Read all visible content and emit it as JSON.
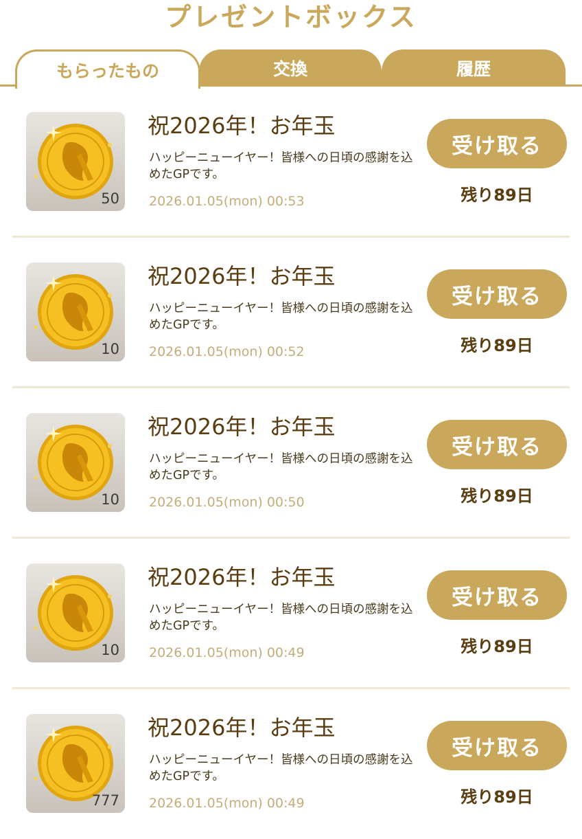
{
  "header": {
    "title": "プレゼントボックス"
  },
  "tabs": [
    {
      "label": "もらったもの",
      "active": true
    },
    {
      "label": "交換",
      "active": false
    },
    {
      "label": "履歴",
      "active": false
    }
  ],
  "colors": {
    "accent": "#c9a75b",
    "text_dark": "#5a3e12",
    "date": "#c5ad7b",
    "divider": "#efe6d4"
  },
  "items": [
    {
      "icon": "gold-coin-icon",
      "quantity": "50",
      "title": "祝2026年！お年玉",
      "description": "ハッピーニューイヤー！皆様への日頃の感謝を込めたGPです。",
      "date": "2026.01.05(mon) 00:53",
      "button_label": "受け取る",
      "remaining": "残り89日"
    },
    {
      "icon": "gold-coin-icon",
      "quantity": "10",
      "title": "祝2026年！お年玉",
      "description": "ハッピーニューイヤー！皆様への日頃の感謝を込めたGPです。",
      "date": "2026.01.05(mon) 00:52",
      "button_label": "受け取る",
      "remaining": "残り89日"
    },
    {
      "icon": "gold-coin-icon",
      "quantity": "10",
      "title": "祝2026年！お年玉",
      "description": "ハッピーニューイヤー！皆様への日頃の感謝を込めたGPです。",
      "date": "2026.01.05(mon) 00:50",
      "button_label": "受け取る",
      "remaining": "残り89日"
    },
    {
      "icon": "gold-coin-icon",
      "quantity": "10",
      "title": "祝2026年！お年玉",
      "description": "ハッピーニューイヤー！皆様への日頃の感謝を込めたGPです。",
      "date": "2026.01.05(mon) 00:49",
      "button_label": "受け取る",
      "remaining": "残り89日"
    },
    {
      "icon": "gold-coin-icon",
      "quantity": "777",
      "title": "祝2026年！お年玉",
      "description": "ハッピーニューイヤー！皆様への日頃の感謝を込めたGPです。",
      "date": "2026.01.05(mon) 00:49",
      "button_label": "受け取る",
      "remaining": "残り89日"
    }
  ]
}
